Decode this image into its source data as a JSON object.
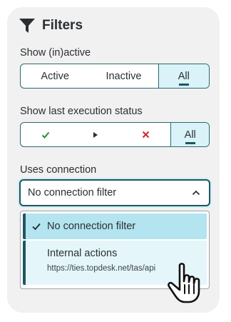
{
  "panel": {
    "title": "Filters",
    "icon": "funnel-icon"
  },
  "active_filter": {
    "label": "Show (in)active",
    "options": [
      "Active",
      "Inactive",
      "All"
    ],
    "selected": "All"
  },
  "status_filter": {
    "label": "Show last execution status",
    "options": [
      {
        "icon": "checkmark-icon",
        "color": "#2e8a2e"
      },
      {
        "icon": "play-icon",
        "color": "#2b2f33"
      },
      {
        "icon": "cross-icon",
        "color": "#d0282a"
      },
      {
        "label": "All"
      }
    ],
    "selected": "All"
  },
  "connection_filter": {
    "label": "Uses connection",
    "value": "No connection filter",
    "options": [
      {
        "label": "No connection filter",
        "selected": true
      },
      {
        "label": "Internal actions",
        "sublabel": "https://ties.topdesk.net/tas/api",
        "selected": false
      }
    ]
  },
  "colors": {
    "accent": "#1f5660",
    "selected_bg": "#b3e4ef",
    "hover_bg": "#e4f6fa",
    "panel_bg": "#f1f1f1"
  }
}
